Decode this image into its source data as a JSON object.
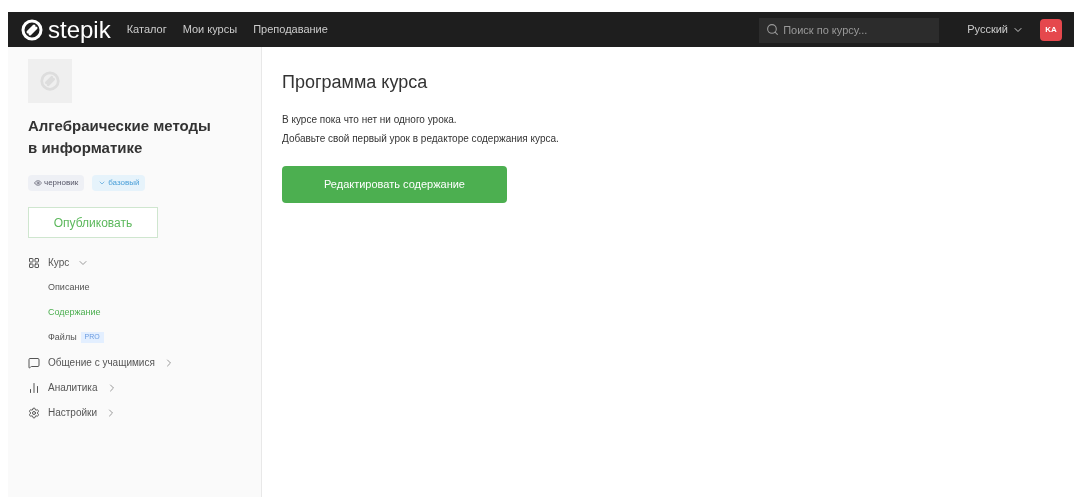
{
  "navbar": {
    "logo": "stepik",
    "links": [
      "Каталог",
      "Мои курсы",
      "Преподавание"
    ],
    "search": {
      "placeholder": "Поиск по курсу..."
    },
    "language": "Русский",
    "avatar": "KA"
  },
  "sidebar": {
    "course_title": "Алгебраические методы в информатике",
    "tags": [
      {
        "label": "черновик",
        "kind": "draft"
      },
      {
        "label": "базовый",
        "kind": "level"
      }
    ],
    "publish_button": "Опубликовать",
    "menu": [
      {
        "label": "Курс",
        "expanded": true,
        "children": [
          {
            "label": "Описание",
            "selected": false
          },
          {
            "label": "Содержание",
            "selected": true
          },
          {
            "label": "Файлы",
            "selected": false,
            "badge": "PRO"
          }
        ]
      },
      {
        "label": "Общение с учащимися",
        "expanded": false
      },
      {
        "label": "Аналитика",
        "expanded": false
      },
      {
        "label": "Настройки",
        "expanded": false
      }
    ]
  },
  "main": {
    "title": "Программа курса",
    "lines": [
      "В курсе пока что нет ни одного урока.",
      "Добавьте свой первый урок в редакторе содержания курса."
    ],
    "edit_button": "Редактировать содержание"
  }
}
